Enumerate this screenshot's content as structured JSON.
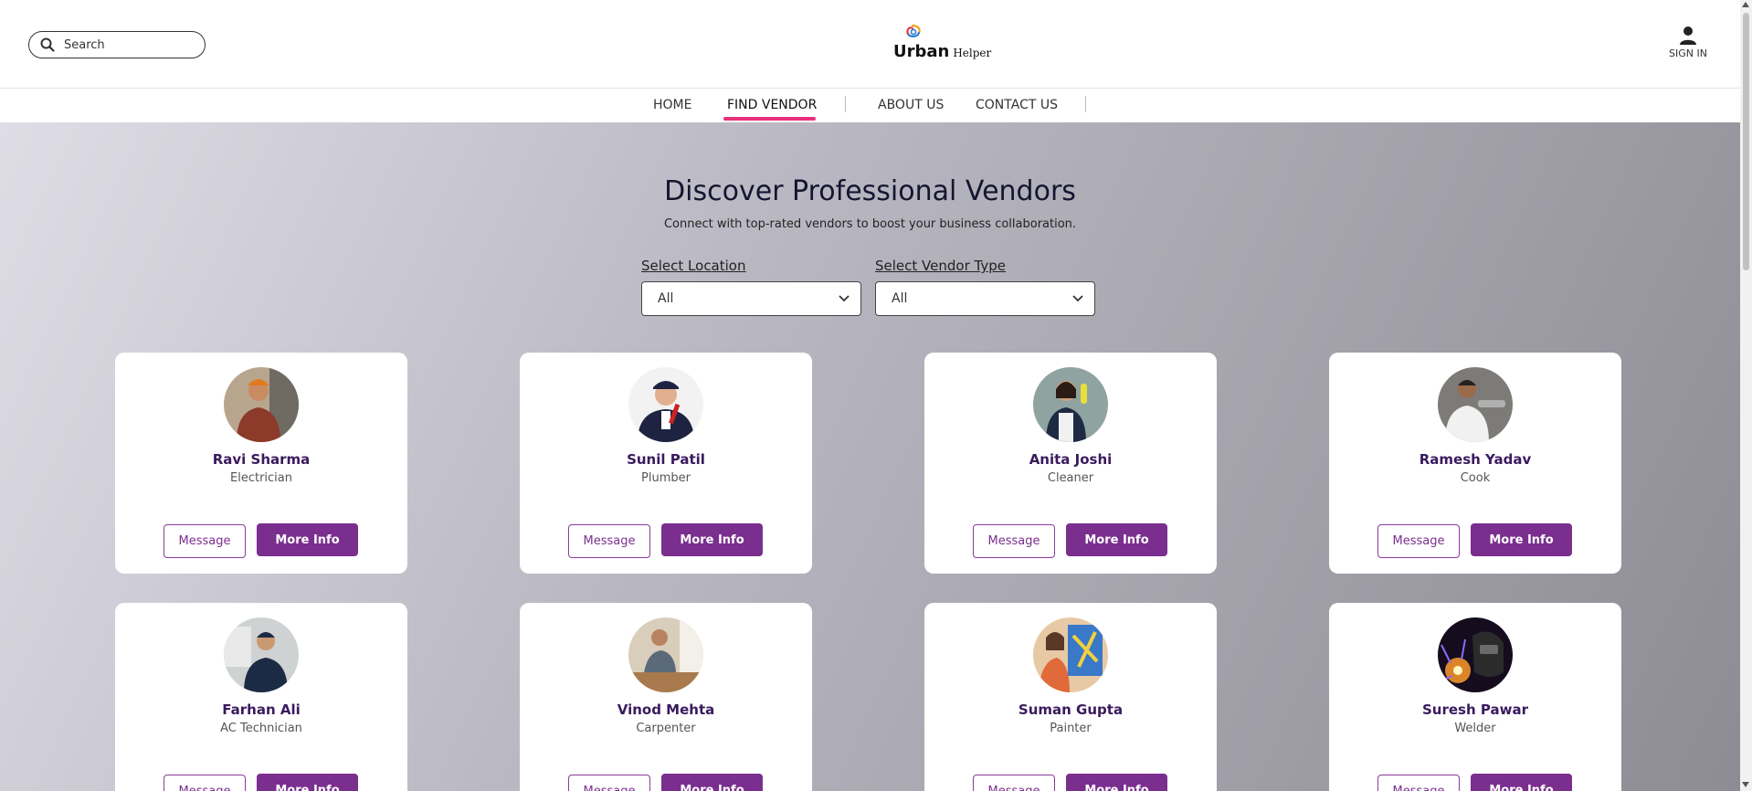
{
  "header": {
    "search_placeholder": "Search",
    "logo_primary": "Urban",
    "logo_secondary": "Helper",
    "signin_label": "SIGN IN"
  },
  "nav": {
    "items": [
      {
        "label": "HOME"
      },
      {
        "label": "FIND VENDOR",
        "active": true
      },
      {
        "label": "ABOUT US"
      },
      {
        "label": "CONTACT US"
      }
    ],
    "accent_color": "#e8307c"
  },
  "hero": {
    "title": "Discover Professional Vendors",
    "subtitle": "Connect with top-rated vendors to boost your business collaboration."
  },
  "filters": {
    "location": {
      "label": "Select Location",
      "value": "All"
    },
    "vendor_type": {
      "label": "Select Vendor Type",
      "value": "All"
    }
  },
  "vendors": [
    {
      "name": "Ravi Sharma",
      "role": "Electrician",
      "message_label": "Message",
      "info_label": "More Info"
    },
    {
      "name": "Sunil Patil",
      "role": "Plumber",
      "message_label": "Message",
      "info_label": "More Info"
    },
    {
      "name": "Anita Joshi",
      "role": "Cleaner",
      "message_label": "Message",
      "info_label": "More Info"
    },
    {
      "name": "Ramesh Yadav",
      "role": "Cook",
      "message_label": "Message",
      "info_label": "More Info"
    },
    {
      "name": "Farhan Ali",
      "role": "AC Technician",
      "message_label": "Message",
      "info_label": "More Info"
    },
    {
      "name": "Vinod Mehta",
      "role": "Carpenter",
      "message_label": "Message",
      "info_label": "More Info"
    },
    {
      "name": "Suman Gupta",
      "role": "Painter",
      "message_label": "Message",
      "info_label": "More Info"
    },
    {
      "name": "Suresh Pawar",
      "role": "Welder",
      "message_label": "Message",
      "info_label": "More Info"
    }
  ],
  "colors": {
    "primary": "#7a2e8e",
    "name_text": "#3a1a5e"
  }
}
